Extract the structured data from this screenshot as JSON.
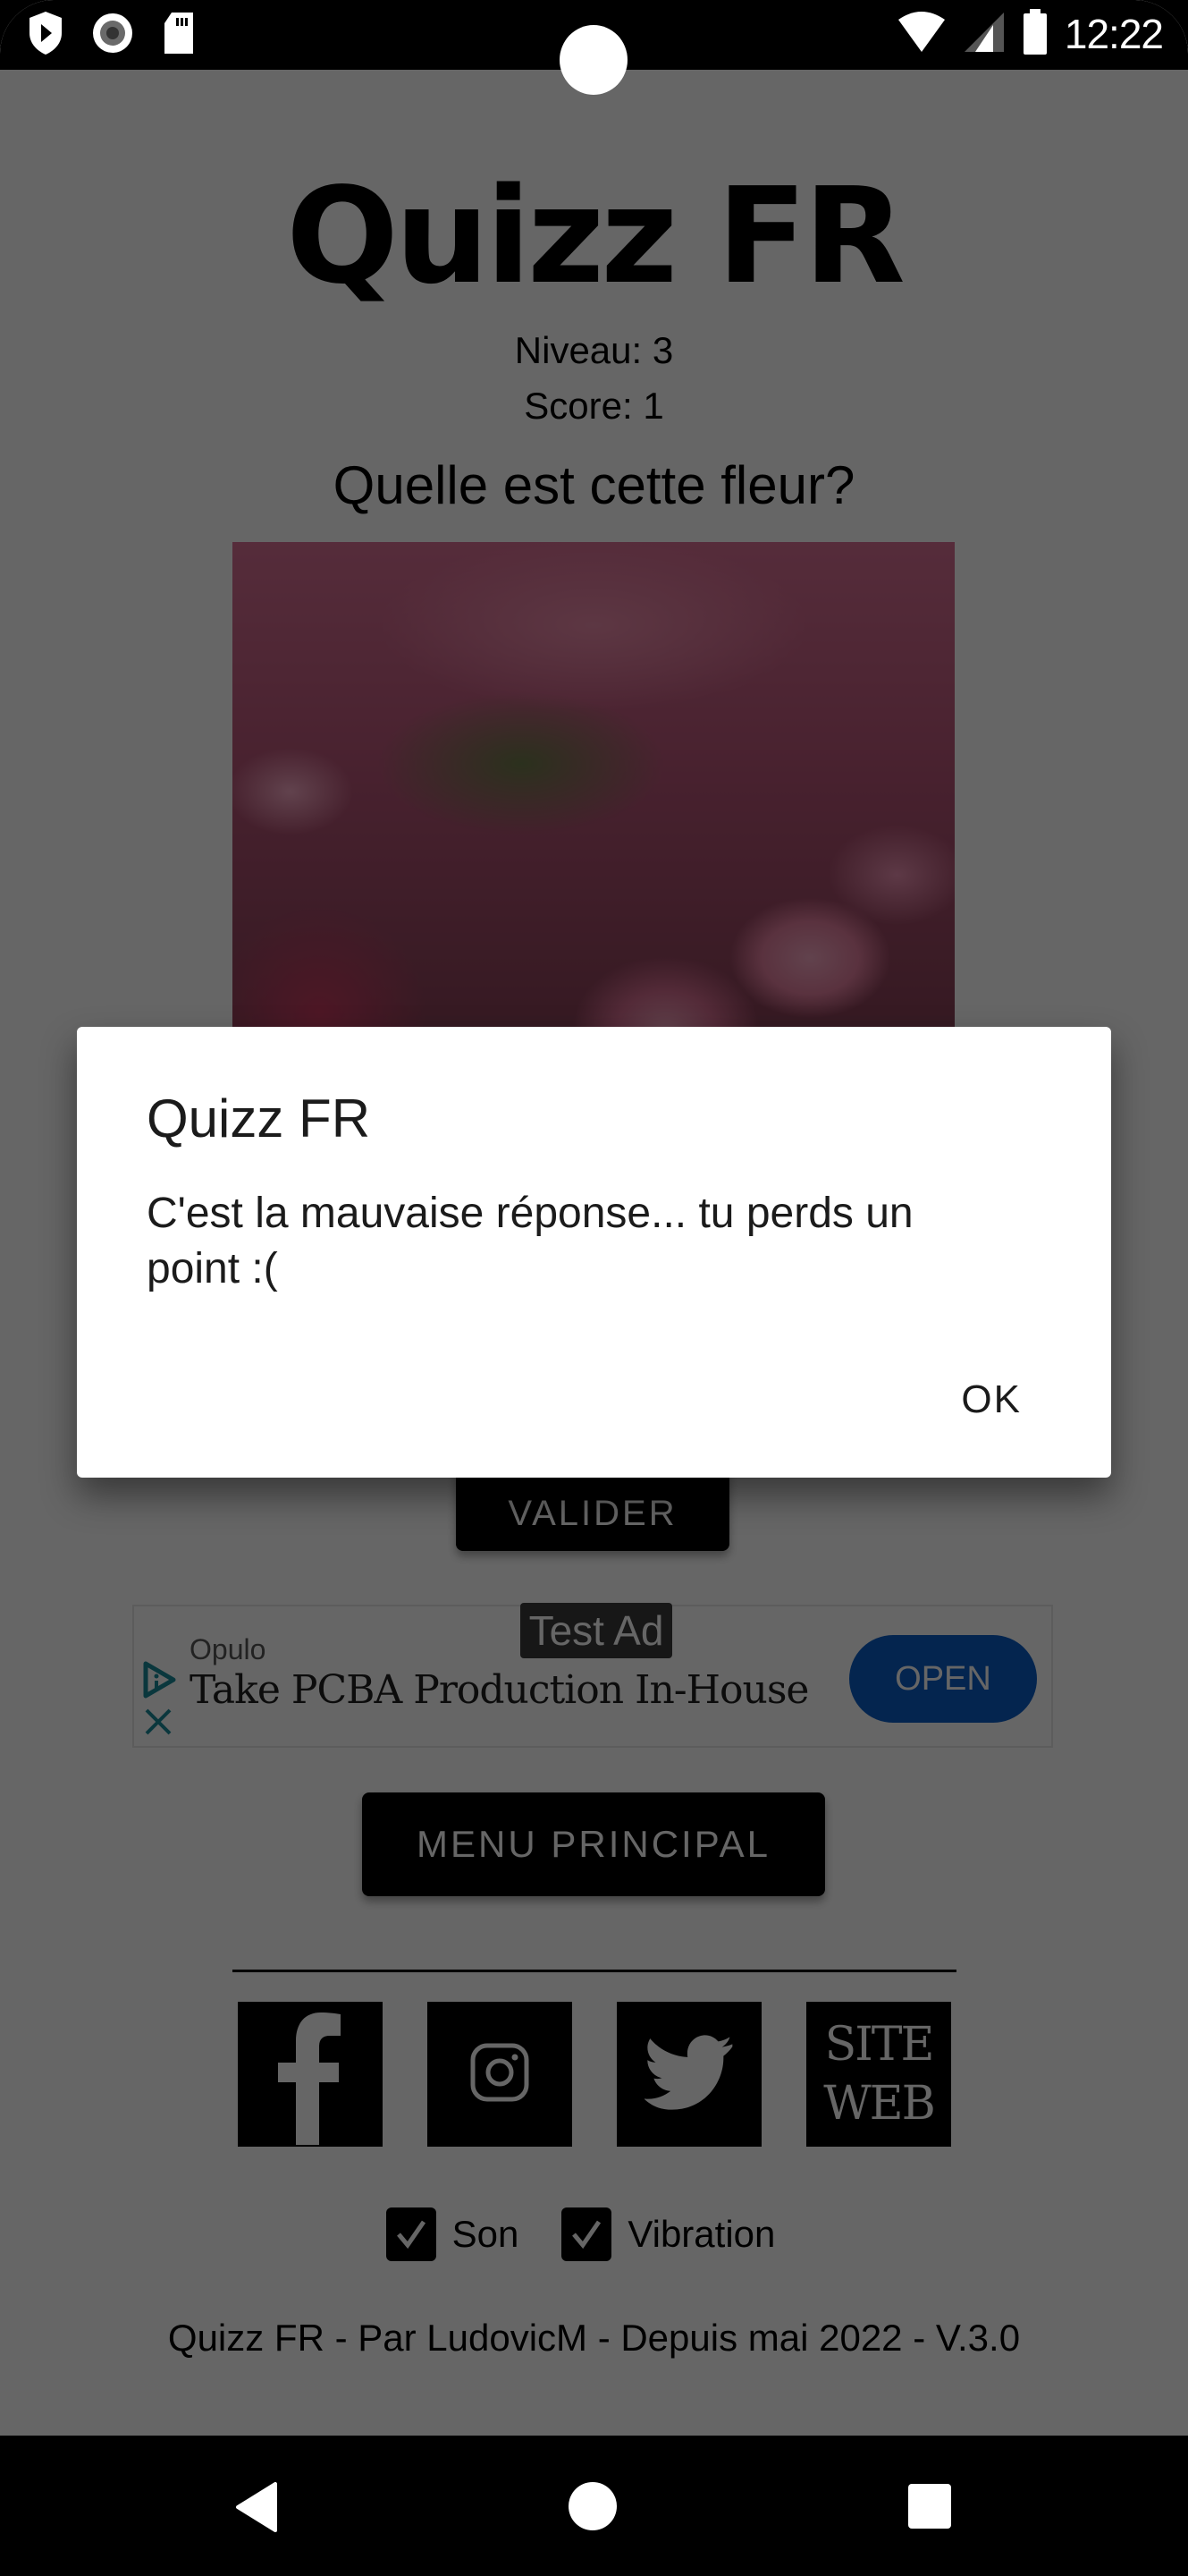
{
  "status_bar": {
    "time": "12:22",
    "left_icons": [
      "play-protect-icon",
      "record-icon",
      "sd-card-icon"
    ],
    "right_icons": [
      "wifi-icon",
      "signal-icon",
      "battery-icon"
    ]
  },
  "app": {
    "title": "Quizz FR",
    "level_label": "Niveau: 3",
    "score_label": "Score: 1",
    "question": "Quelle est cette fleur?",
    "image_alt": "pink flowers",
    "validate_button": "VALIDER",
    "main_menu_button": "MENU PRINCIPAL",
    "social_links": [
      {
        "name": "Facebook",
        "icon": "facebook-icon"
      },
      {
        "name": "Instagram",
        "icon": "instagram-icon"
      },
      {
        "name": "Twitter",
        "icon": "twitter-icon"
      },
      {
        "name": "Site web",
        "label_line1": "SITE",
        "label_line2": "WEB"
      }
    ],
    "checkboxes": [
      {
        "label": "Son",
        "checked": true
      },
      {
        "label": "Vibration",
        "checked": true
      }
    ],
    "footer": "Quizz FR - Par LudovicM - Depuis mai 2022 - V.3.0"
  },
  "ad": {
    "badge": "Test Ad",
    "brand": "Opulo",
    "headline": "Take PCBA Production In-House",
    "cta": "OPEN",
    "accent_color": "#0b5cc5",
    "icon_color": "#1a8a99"
  },
  "dialog": {
    "title": "Quizz FR",
    "message": "C'est la mauvaise réponse... tu perds un point :(",
    "ok_button": "OK"
  },
  "navigation": {
    "buttons": [
      "back",
      "home",
      "recents"
    ]
  }
}
